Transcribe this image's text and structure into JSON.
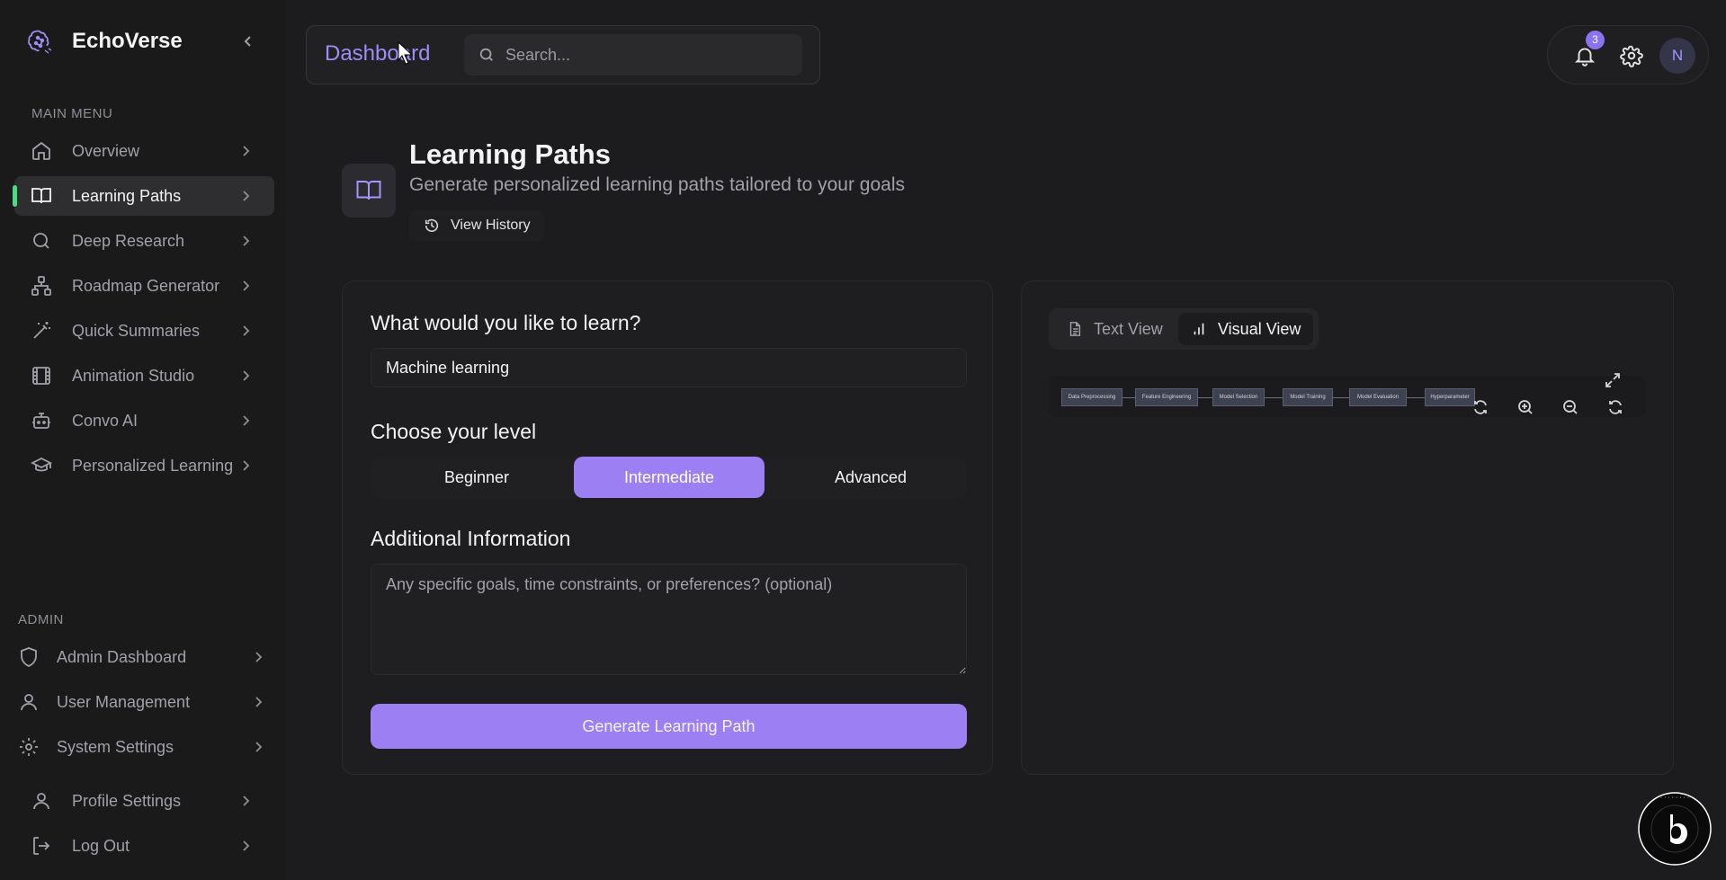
{
  "app": {
    "name": "EchoVerse"
  },
  "sidebar": {
    "main_menu_label": "MAIN MENU",
    "items": [
      {
        "label": "Overview",
        "icon": "home-icon"
      },
      {
        "label": "Learning Paths",
        "icon": "book-open-icon",
        "active": true
      },
      {
        "label": "Deep Research",
        "icon": "search-icon"
      },
      {
        "label": "Roadmap Generator",
        "icon": "network-icon"
      },
      {
        "label": "Quick Summaries",
        "icon": "magic-wand-icon"
      },
      {
        "label": "Animation Studio",
        "icon": "film-icon"
      },
      {
        "label": "Convo AI",
        "icon": "bot-icon"
      },
      {
        "label": "Personalized Learning",
        "icon": "graduation-cap-icon"
      }
    ],
    "admin_label": "ADMIN",
    "admin_items": [
      {
        "label": "Admin Dashboard",
        "icon": "shield-icon"
      },
      {
        "label": "User Management",
        "icon": "user-icon"
      },
      {
        "label": "System Settings",
        "icon": "gear-icon"
      }
    ],
    "bottom_items": [
      {
        "label": "Profile Settings",
        "icon": "user-icon"
      },
      {
        "label": "Log Out",
        "icon": "logout-icon"
      }
    ]
  },
  "topbar": {
    "breadcrumb": "Dashboard",
    "search_placeholder": "Search...",
    "notification_count": "3",
    "avatar_initial": "N"
  },
  "header": {
    "title": "Learning Paths",
    "subtitle": "Generate personalized learning paths tailored to your goals",
    "history_label": "View History"
  },
  "form": {
    "topic_label": "What would you like to learn?",
    "topic_value": "Machine learning",
    "level_label": "Choose your level",
    "levels": [
      "Beginner",
      "Intermediate",
      "Advanced"
    ],
    "selected_level": "Intermediate",
    "notes_label": "Additional Information",
    "notes_placeholder": "Any specific goals, time constraints, or preferences? (optional)",
    "submit_label": "Generate Learning Path"
  },
  "visualization": {
    "tabs": [
      "Text View",
      "Visual View"
    ],
    "active_tab": "Visual View",
    "nodes": [
      "Data Preprocessing",
      "Feature Engineering",
      "Model Selection",
      "Model Training",
      "Model Evaluation",
      "Hyperparameter"
    ]
  },
  "colors": {
    "accent": "#9b7ff3",
    "active_indicator": "#4ade80",
    "background": "#1c1c1e"
  }
}
